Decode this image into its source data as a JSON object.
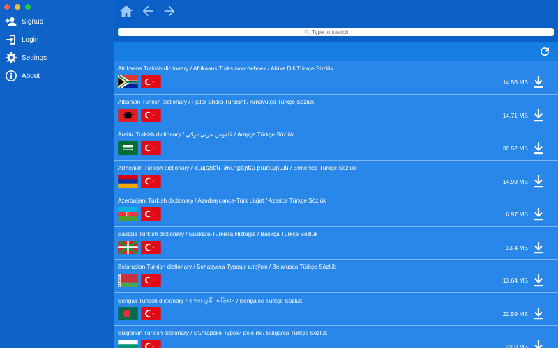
{
  "window": {
    "traffic_colors": [
      "#fc5f57",
      "#fdbc2e",
      "#28c840"
    ]
  },
  "sidebar": {
    "items": [
      {
        "label": "Signup",
        "icon": "add-user-icon"
      },
      {
        "label": "Login",
        "icon": "login-icon"
      },
      {
        "label": "Settings",
        "icon": "gear-icon"
      },
      {
        "label": "About",
        "icon": "info-icon"
      }
    ]
  },
  "topbar": {
    "icons": [
      "home-icon",
      "back-arrow-icon",
      "forward-arrow-icon"
    ]
  },
  "search": {
    "placeholder": "Type to search"
  },
  "colors": {
    "sidebar": "#0f62c8",
    "row": "#2a87ea",
    "row_divider": "#7db7f5",
    "toolbar": "#167ee2"
  },
  "dictionaries": [
    {
      "title": "Afrikaans Turkish dictionary / Afrikaans Turks woordeboek / Afrika Dili Türkçe Sözlük",
      "size": "14.56 МБ",
      "flag": "south-africa"
    },
    {
      "title": "Albanian Turkish dictionary / Fjalor Shqip-Turqisht / Arnavutça Türkçe Sözlük",
      "size": "14.71 МБ",
      "flag": "albania"
    },
    {
      "title": "Arabic Turkish dictionary / قاموس عربي-تركي / Arapça Türkçe Sözlük",
      "size": "32.52 МБ",
      "flag": "saudi-arabia"
    },
    {
      "title": "Armenian Turkish dictionary / Հայերեն-Թուրքերեն բառարան / Ermenice Türkçe Sözlük",
      "size": "14.93 МБ",
      "flag": "armenia"
    },
    {
      "title": "Azerbaijani Turkish dictionary / Azərbaycanca-Türk Lüğət / Azerice Türkçe Sözlük",
      "size": "6.97 МБ",
      "flag": "azerbaijan"
    },
    {
      "title": "Basque Turkish dictionary / Euskara-Turkiera Hiztegia / Baskça Türkçe Sözlük",
      "size": "13.4 МБ",
      "flag": "basque"
    },
    {
      "title": "Belarusian Turkish dictionary / Беларуска-Турацкі слоўнік / Belarusça Türkçe Sözlük",
      "size": "13.64 МБ",
      "flag": "belarus"
    },
    {
      "title": "Bengali Turkish dictionary / বাংলা-তুর্কী অভিধান / Bengalce Türkçe Sözlük",
      "size": "22.59 МБ",
      "flag": "bangladesh"
    },
    {
      "title": "Bulgarian Turkish dictionary / Българско-Турски речник / Bulgarca Türkçe Sözlük",
      "size": "22.0 МБ",
      "flag": "bulgaria"
    }
  ]
}
